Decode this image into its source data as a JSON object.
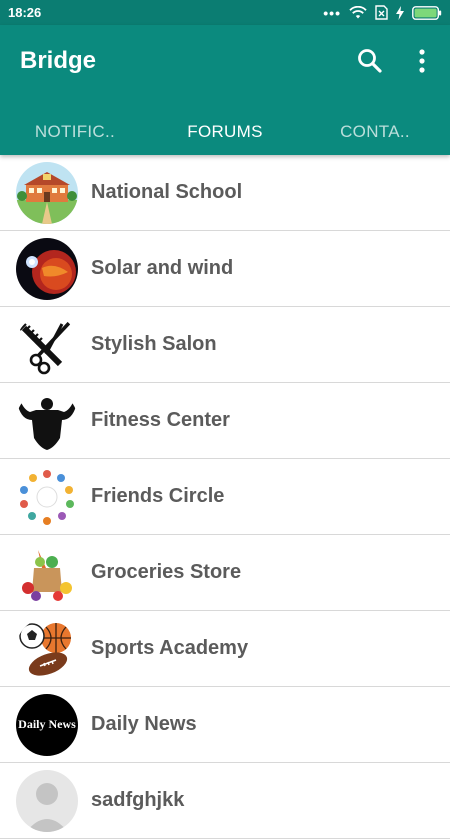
{
  "status": {
    "time": "18:26",
    "signal_dots": "•••"
  },
  "app": {
    "title": "Bridge"
  },
  "tabs": [
    {
      "label": "NOTIFIC.."
    },
    {
      "label": "FORUMS"
    },
    {
      "label": "CONTA.."
    }
  ],
  "forums": [
    {
      "name": "National School",
      "icon": "school-building-icon"
    },
    {
      "name": "Solar and wind",
      "icon": "solar-flare-icon"
    },
    {
      "name": "Stylish Salon",
      "icon": "comb-scissors-icon"
    },
    {
      "name": "Fitness Center",
      "icon": "bodybuilder-icon"
    },
    {
      "name": "Friends Circle",
      "icon": "friends-circle-icon"
    },
    {
      "name": "Groceries Store",
      "icon": "grocery-bag-icon"
    },
    {
      "name": "Sports Academy",
      "icon": "sports-balls-icon"
    },
    {
      "name": "Daily News",
      "icon": "newspaper-icon",
      "avatar_text": "Daily News"
    },
    {
      "name": "sadfghjkk",
      "icon": "default-avatar-icon"
    }
  ],
  "colors": {
    "primary": "#0b8a7e",
    "status_bar": "#0b7d72",
    "text": "#5b5b5b"
  }
}
